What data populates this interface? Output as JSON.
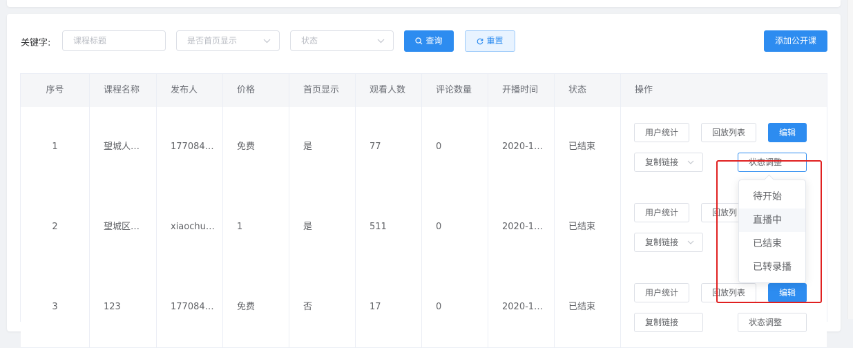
{
  "filters": {
    "keyword_label": "关键字:",
    "keyword_placeholder": "课程标题",
    "homepage_placeholder": "是否首页显示",
    "status_placeholder": "状态",
    "query_label": "查询",
    "reset_label": "重置",
    "add_label": "添加公开课"
  },
  "table": {
    "headers": [
      "序号",
      "课程名称",
      "发布人",
      "价格",
      "首页显示",
      "观看人数",
      "评论数量",
      "开播时间",
      "状态",
      "操作"
    ],
    "rows": [
      {
        "index": "1",
        "name": "望城人…",
        "publisher": "177084…",
        "price": "免费",
        "homepage": "是",
        "viewers": "77",
        "comments": "0",
        "start_time": "2020-1…",
        "status": "已结束"
      },
      {
        "index": "2",
        "name": "望城区…",
        "publisher": "xiaochu…",
        "price": "1",
        "homepage": "是",
        "viewers": "511",
        "comments": "0",
        "start_time": "2020-1…",
        "status": "已结束"
      },
      {
        "index": "3",
        "name": "123",
        "publisher": "177084…",
        "price": "免费",
        "homepage": "否",
        "viewers": "17",
        "comments": "0",
        "start_time": "2020-1…",
        "status": "已结束"
      }
    ],
    "actions": {
      "user_stats": "用户统计",
      "replay_list": "回放列表",
      "replay_list_partial": "回放列",
      "edit": "编辑",
      "copy_link": "复制链接",
      "status_adjust": "状态调整"
    }
  },
  "status_dropdown": {
    "options": [
      "待开始",
      "直播中",
      "已结束",
      "已转录播"
    ],
    "hovered": "直播中"
  },
  "colors": {
    "primary": "#2d8cf0",
    "highlight": "#e02020"
  }
}
